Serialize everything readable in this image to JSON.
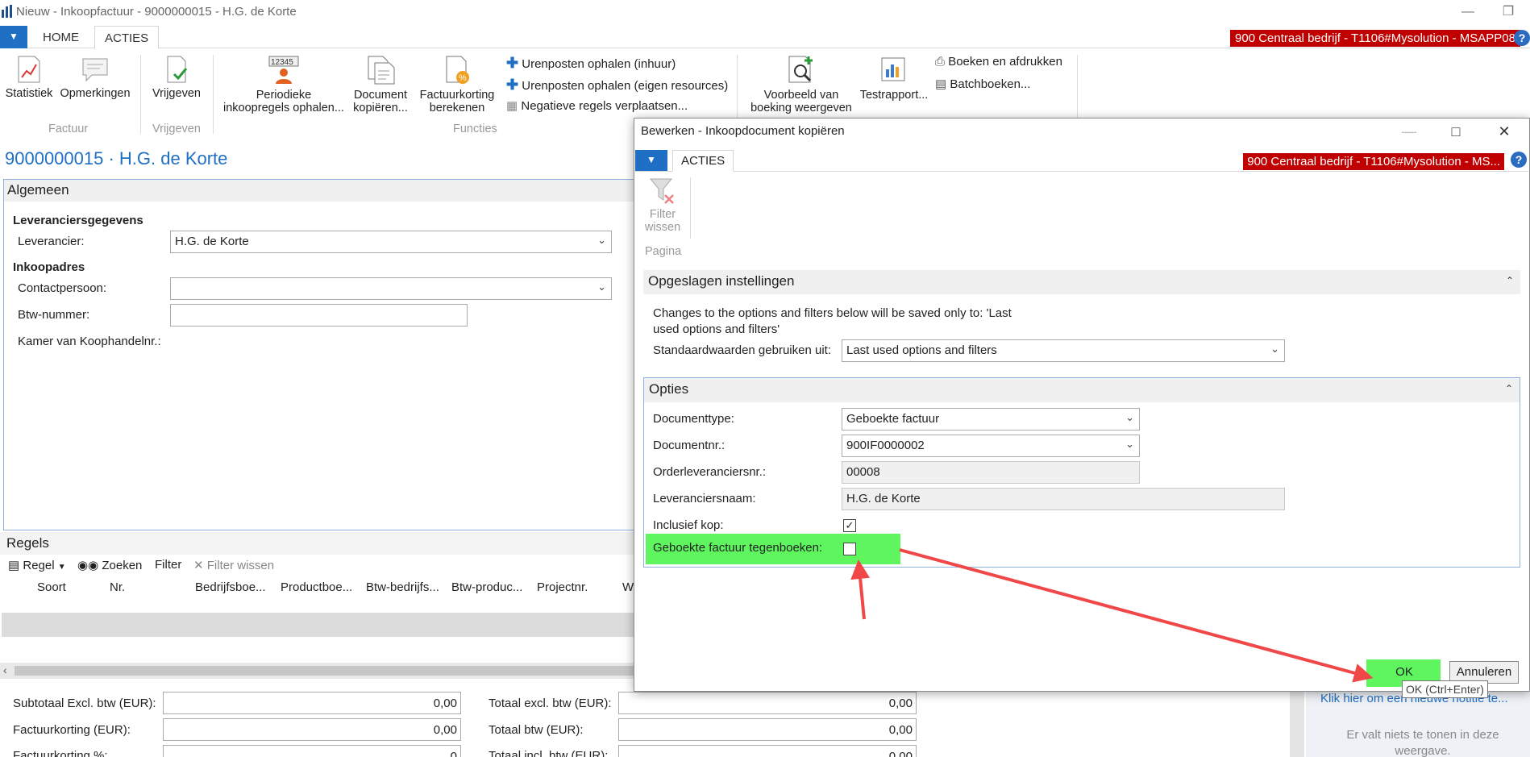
{
  "window": {
    "title": "Nieuw - Inkoopfactuur - 9000000015 - H.G. de Korte"
  },
  "ribbon": {
    "tabs": [
      "HOME",
      "ACTIES"
    ],
    "company": "900 Centraal bedrijf - T1106#Mysolution - MSAPP08",
    "statistiek": "Statistiek",
    "opmerkingen": "Opmerkingen",
    "factuur_group": "Factuur",
    "vrijgeven": "Vrijgeven",
    "vrijgeven_group": "Vrijgeven",
    "periodieke_1": "Periodieke",
    "periodieke_2": "inkoopregels ophalen...",
    "document_1": "Document",
    "document_2": "kopiëren...",
    "factuurkorting_1": "Factuurkorting",
    "factuurkorting_2": "berekenen",
    "functies_group": "Functies",
    "urenposten_inhuur": "Urenposten ophalen (inhuur)",
    "urenposten_eigen": "Urenposten ophalen (eigen resources)",
    "negatieve": "Negatieve regels verplaatsen...",
    "voorbeeld_1": "Voorbeeld van",
    "voorbeeld_2": "boeking weergeven",
    "testrapport": "Testrapport...",
    "boeken_afdrukken": "Boeken en afdrukken",
    "batchboeken": "Batchboeken..."
  },
  "page": {
    "title": "9000000015 · H.G. de Korte"
  },
  "algemeen": {
    "header": "Algemeen",
    "leveranciersgegevens": "Leveranciersgegevens",
    "leverancier_label": "Leverancier:",
    "leverancier_value": "H.G. de Korte",
    "inkoopadres": "Inkoopadres",
    "contactpersoon_label": "Contactpersoon:",
    "contactpersoon_value": "",
    "btw_label": "Btw-nummer:",
    "btw_value": "",
    "kvk_label": "Kamer van Koophandelnr.:"
  },
  "regels": {
    "header": "Regels",
    "regel": "Regel",
    "zoeken": "Zoeken",
    "filter": "Filter",
    "filter_wissen": "Filter wissen",
    "columns": [
      "Soort",
      "Nr.",
      "Bedrijfsboe...",
      "Productboe...",
      "Btw-bedrijfs...",
      "Btw-produc...",
      "Projectnr.",
      "W"
    ]
  },
  "totals": {
    "subtotaal_label": "Subtotaal Excl. btw (EUR):",
    "subtotaal_value": "0,00",
    "factuurkorting_label": "Factuurkorting (EUR):",
    "factuurkorting_value": "0,00",
    "factuurkorting_pct_label": "Factuurkorting %:",
    "factuurkorting_pct_value": "0",
    "totaal_excl_label": "Totaal excl. btw (EUR):",
    "totaal_excl_value": "0,00",
    "totaal_btw_label": "Totaal btw (EUR):",
    "totaal_btw_value": "0,00",
    "totaal_incl_label": "Totaal incl. btw (EUR):",
    "totaal_incl_value": "0,00"
  },
  "notes": {
    "link": "Klik hier om een nieuwe notitie te...",
    "empty_1": "Er valt niets te tonen in deze",
    "empty_2": "weergave."
  },
  "dialog": {
    "title": "Bewerken - Inkoopdocument kopiëren",
    "tab": "ACTIES",
    "company": "900 Centraal bedrijf - T1106#Mysolution - MS...",
    "filter_wissen_1": "Filter",
    "filter_wissen_2": "wissen",
    "pagina": "Pagina",
    "opgeslagen_header": "Opgeslagen instellingen",
    "opgeslagen_note_1": "Changes to the options and filters below will be saved only to: 'Last",
    "opgeslagen_note_2": "used options and filters'",
    "standaard_label": "Standaardwaarden gebruiken uit:",
    "standaard_value": "Last used options and filters",
    "opties_header": "Opties",
    "documenttype_label": "Documenttype:",
    "documenttype_value": "Geboekte factuur",
    "documentnr_label": "Documentnr.:",
    "documentnr_value": "900IF0000002",
    "orderlev_label": "Orderleveranciersnr.:",
    "orderlev_value": "00008",
    "levnaam_label": "Leveranciersnaam:",
    "levnaam_value": "H.G. de Korte",
    "inclusief_label": "Inclusief kop:",
    "inclusief_checked": true,
    "tegenboeken_label": "Geboekte factuur tegenboeken:",
    "tegenboeken_checked": false,
    "ok": "OK",
    "annuleren": "Annuleren",
    "tooltip": "OK (Ctrl+Enter)"
  },
  "colors": {
    "accent_blue": "#1f6fc5",
    "company_red": "#c00000",
    "highlight_green": "#5ef55e",
    "arrow_red": "#f04848"
  }
}
